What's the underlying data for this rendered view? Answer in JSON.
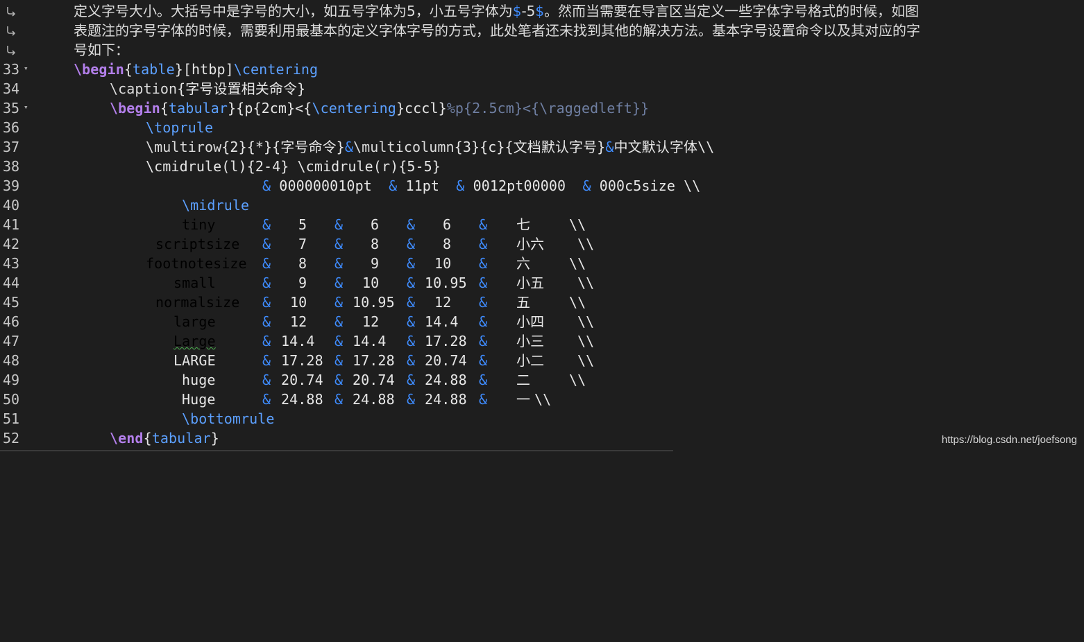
{
  "prose": {
    "line1_a": "定义字号大小。大括号中是字号的大小，如五号字体为5，小五号字体为",
    "line1_dollar1": "$",
    "line1_b": "-5",
    "line1_dollar2": "$",
    "line1_c": "。然而当需要在导言区当定义一些字体字号格式的时候，如图",
    "line2": "表题注的字号字体的时候，需要利用最基本的定义字体字号的方式，此处笔者还未找到其他的解决方法。基本字号设置命令以及其对应的字",
    "line3": "号如下："
  },
  "line_numbers": [
    "33",
    "34",
    "35",
    "36",
    "37",
    "38",
    "39",
    "40",
    "41",
    "42",
    "43",
    "44",
    "45",
    "46",
    "47",
    "48",
    "49",
    "50",
    "51",
    "52"
  ],
  "code": {
    "l33": {
      "cmd": "\\begin",
      "b1": "{",
      "arg": "table",
      "b2": "}",
      "opt": "[htbp]",
      "cmd2": "\\centering"
    },
    "l34": {
      "cmd": "\\caption",
      "rest": "{字号设置相关命令}"
    },
    "l35": {
      "cmd": "\\begin",
      "b1": "{",
      "arg": "tabular",
      "b2": "}",
      "a": "{p{2cm}<{",
      "cen": "\\centering",
      "b": "}cccl}",
      "cmt": "%p{2.5cm}<{\\raggedleft}}"
    },
    "l36": {
      "cmd": "\\toprule"
    },
    "l37": {
      "cmd": "\\multirow",
      "a": "{2}{*}{字号命令}",
      "amp": "&",
      "cmd2": "\\multicolumn",
      "b": "{3}{c}{文档默认字号}",
      "amp2": "&",
      "c": "中文默认字体\\\\"
    },
    "l38": {
      "text": "\\cmidrule(l){2-4} \\cmidrule(r){5-5}"
    },
    "l39": {
      "amp1": "&",
      "v1": " 000000010pt  ",
      "amp2": "&",
      "v2": " 11pt  ",
      "amp3": "&",
      "v3": " 0012pt00000  ",
      "amp4": "&",
      "v4": " 000c5size \\\\"
    },
    "l40": {
      "cmd": "\\midrule"
    },
    "l51": {
      "cmd": "\\bottomrule"
    },
    "l52": {
      "cmd": "\\end",
      "b1": "{",
      "arg": "tabular",
      "b2": "}"
    }
  },
  "rows": [
    {
      "name": "tiny",
      "c1": "5",
      "c2": "6",
      "c3": "6",
      "zh": "七",
      "end": "\\\\"
    },
    {
      "name": "scriptsize",
      "c1": "7",
      "c2": "8",
      "c3": "8",
      "zh": "小六",
      "end": "\\\\"
    },
    {
      "name": "footnotesize",
      "c1": "8",
      "c2": "9",
      "c3": "10",
      "zh": "六",
      "end": "\\\\"
    },
    {
      "name": "small",
      "c1": "9",
      "c2": "10",
      "c3": "10.95",
      "zh": "小五",
      "end": "\\\\"
    },
    {
      "name": "normalsize",
      "c1": "10",
      "c2": "10.95",
      "c3": "12",
      "zh": "五",
      "end": "\\\\"
    },
    {
      "name": "large",
      "c1": "12",
      "c2": "12",
      "c3": "14.4",
      "zh": "小四",
      "end": "\\\\"
    },
    {
      "name": "Large",
      "c1": "14.4",
      "c2": "14.4",
      "c3": "17.28",
      "zh": "小三",
      "end": "\\\\"
    },
    {
      "name": "LARGE",
      "c1": "17.28",
      "c2": "17.28",
      "c3": "20.74",
      "zh": "小二",
      "end": "\\\\"
    },
    {
      "name": "huge",
      "c1": "20.74",
      "c2": "20.74",
      "c3": "24.88",
      "zh": "二",
      "end": "\\\\"
    },
    {
      "name": "Huge",
      "c1": "24.88",
      "c2": "24.88",
      "c3": "24.88",
      "zh": "一",
      "end": "\\\\"
    }
  ],
  "amp": "&",
  "watermark": "https://blog.csdn.net/joefsong",
  "colors": {
    "background": "#1e1e1e",
    "keyword": "#b37feb",
    "argument": "#5ca0ff",
    "ampersand": "#3f8cff",
    "comment": "#6f7fa2"
  },
  "icons": {
    "wrap": "wrap-continuation-icon",
    "fold": "fold-arrow-icon"
  }
}
